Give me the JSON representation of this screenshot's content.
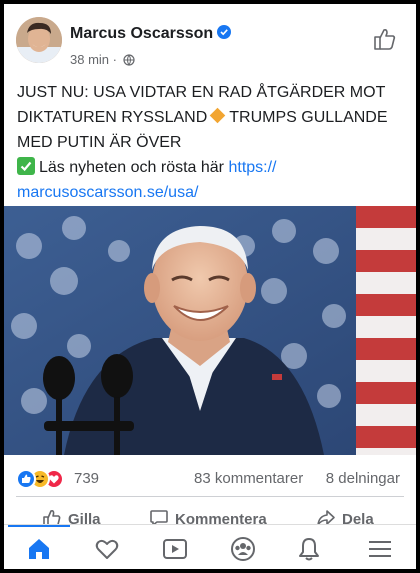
{
  "post": {
    "author": "Marcus Oscarsson",
    "time": "38 min",
    "time_separator": "·",
    "line1": "JUST NU: USA VIDTAR EN RAD ÅTGÄRDER MOT DIKTATUREN RYSSLAND",
    "line1b": "TRUMPS GULLANDE MED PUTIN ÄR ÖVER",
    "cta_text": "Läs nyheten och rösta här",
    "link_text": "https:// marcusoscarsson.se/usa/"
  },
  "stats": {
    "reaction_count": "739",
    "comments": "83 kommentarer",
    "shares": "8 delningar"
  },
  "actions": {
    "like": "Gilla",
    "comment": "Kommentera",
    "share": "Dela"
  },
  "icons": {
    "header_like": "thumbs-up-outline-icon",
    "verified": "verified-badge-icon",
    "privacy": "globe-icon",
    "nav": [
      "home-icon",
      "heart-icon",
      "video-icon",
      "groups-icon",
      "bell-icon",
      "menu-icon"
    ]
  },
  "colors": {
    "accent": "#1877f2",
    "text": "#1c1e21",
    "muted": "#65676b"
  }
}
